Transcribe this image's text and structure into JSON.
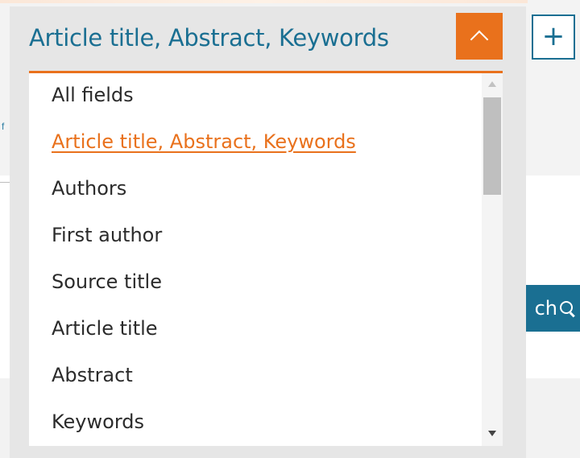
{
  "background": {
    "left_fragment_text": "f",
    "search_button_label": "ch",
    "add_button_symbol": "+"
  },
  "dropdown": {
    "selected_value": "Article title, Abstract, Keywords",
    "expanded": true,
    "options": [
      {
        "label": "All fields",
        "selected": false
      },
      {
        "label": "Article title, Abstract, Keywords",
        "selected": true
      },
      {
        "label": "Authors",
        "selected": false
      },
      {
        "label": "First author",
        "selected": false
      },
      {
        "label": "Source title",
        "selected": false
      },
      {
        "label": "Article title",
        "selected": false
      },
      {
        "label": "Abstract",
        "selected": false
      },
      {
        "label": "Keywords",
        "selected": false
      }
    ],
    "scroll_position_fraction": 0.0
  },
  "colors": {
    "accent_orange": "#e9711c",
    "link_blue": "#1a6f92",
    "panel_gray": "#e6e6e6"
  },
  "icons": {
    "collapse": "chevron-up-icon",
    "search": "search-icon",
    "add": "plus-icon"
  }
}
